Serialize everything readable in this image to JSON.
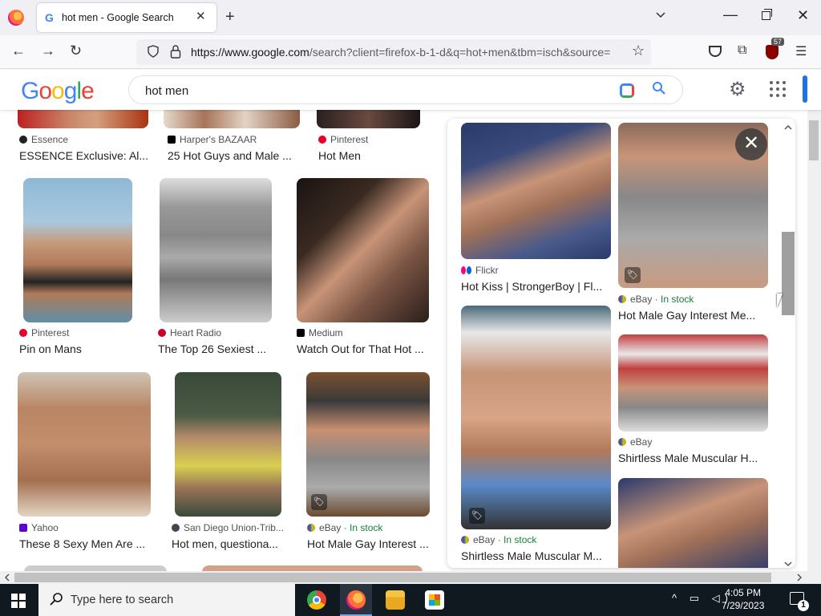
{
  "browser": {
    "tab_title": "hot men - Google Search",
    "tab_favicon": "G",
    "url_domain": "https://www.google.com",
    "url_rest": "/search?client=firefox-b-1-d&q=hot+men&tbm=isch&source=",
    "extension_badge": "57"
  },
  "google": {
    "logo": [
      "G",
      "o",
      "o",
      "g",
      "l",
      "e"
    ],
    "logo_colors": [
      "#4285f4",
      "#ea4335",
      "#fbbc05",
      "#4285f4",
      "#34a853",
      "#ea4335"
    ],
    "query": "hot men"
  },
  "results": [
    {
      "source": "Essence",
      "title": "ESSENCE Exclusive: Al...",
      "fav": "#222"
    },
    {
      "source": "Harper's BAZAAR",
      "title": "25 Hot Guys and Male ...",
      "fav": "#000"
    },
    {
      "source": "Pinterest",
      "title": "Hot Men",
      "fav": "#e60023"
    },
    {
      "source": "Pinterest",
      "title": "Pin on Mans",
      "fav": "#e60023"
    },
    {
      "source": "Heart Radio",
      "title": "The Top 26 Sexiest ...",
      "fav": "#c6002b"
    },
    {
      "source": "Medium",
      "title": "Watch Out for That Hot ...",
      "fav": "#000"
    },
    {
      "source": "Yahoo",
      "title": "These 8 Sexy Men Are ...",
      "fav": "#6001d2"
    },
    {
      "source": "San Diego Union-Trib...",
      "title": "Hot men, questiona...",
      "fav": "#445"
    },
    {
      "source": "eBay",
      "stock": "In stock",
      "title": "Hot Male Gay Interest ...",
      "fav": "#e53238"
    }
  ],
  "panel_results": [
    {
      "source": "Flickr",
      "title": "Hot Kiss | StrongerBoy | Fl...",
      "fav": "#ff0084"
    },
    {
      "source": "eBay",
      "stock": "In stock",
      "title": "Hot Male Gay Interest Me...",
      "fav": "#e53238"
    },
    {
      "source": "eBay",
      "stock": "In stock",
      "title": "Shirtless Male Muscular M...",
      "fav": "#e53238"
    },
    {
      "source": "eBay",
      "title": "Shirtless Male Muscular H...",
      "fav": "#e53238"
    }
  ],
  "stock_sep": " · ",
  "taskbar": {
    "search_placeholder": "Type here to search",
    "time": "4:05 PM",
    "date": "7/29/2023",
    "notification_count": "1"
  },
  "icons": {
    "tab_close": "✕",
    "new_tab": "+",
    "back": "←",
    "forward": "→",
    "reload": "↻",
    "star": "☆",
    "menu": "☰",
    "close_panel": "✕",
    "tag": "🏷"
  }
}
